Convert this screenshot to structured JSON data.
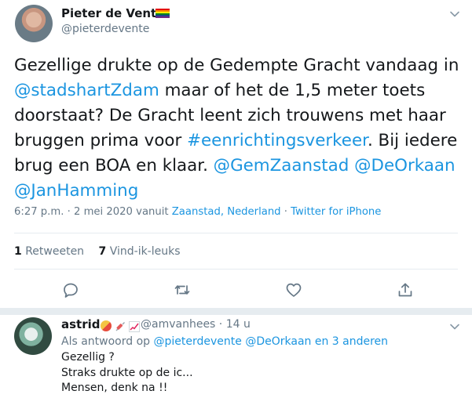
{
  "tweet": {
    "author_name": "Pieter de Vente",
    "author_flag": "rainbow-flag",
    "author_handle": "@pieterdevente",
    "text_1": "Gezellige drukte op de Gedempte Gracht vandaag in ",
    "mention_1": "@stadshartZdam",
    "text_2": " maar of het de 1,5 meter toets doorstaat? De Gracht leent zich trouwens met haar bruggen prima voor ",
    "hashtag_1": "#eenrichtingsverkeer",
    "text_3": ". Bij iedere brug een BOA en klaar. ",
    "mention_2": "@GemZaanstad",
    "mention_3": "@DeOrkaan",
    "mention_4": "@JanHamming",
    "meta_time": "6:27 p.m. · 2 mei 2020 vanuit ",
    "meta_location": "Zaanstad, Nederland",
    "meta_sep": " · ",
    "meta_source": "Twitter for iPhone",
    "retweets_count": "1",
    "retweets_label": "Retweeten",
    "likes_count": "7",
    "likes_label": "Vind-ik-leuks"
  },
  "actions": {
    "reply_icon": "reply-icon",
    "retweet_icon": "retweet-icon",
    "like_icon": "heart-icon",
    "share_icon": "share-icon"
  },
  "reply": {
    "author_name": "astrid",
    "author_emojis": [
      "pill-emoji",
      "syringe-emoji",
      "chart-increasing-emoji"
    ],
    "author_handle": "@amvanhees · 14 u",
    "context_prefix": "Als antwoord op ",
    "context_mention_1": "@pieterdevente",
    "context_mention_2": "@DeOrkaan",
    "context_more": "en 3 anderen",
    "line_1": "Gezellig ?",
    "line_2": "Straks drukte op de ic...",
    "line_3": "Mensen, denk na !!"
  },
  "colors": {
    "link": "#1b95e0",
    "secondary": "#657786",
    "text": "#14171a",
    "divider": "#e6ecf0"
  }
}
